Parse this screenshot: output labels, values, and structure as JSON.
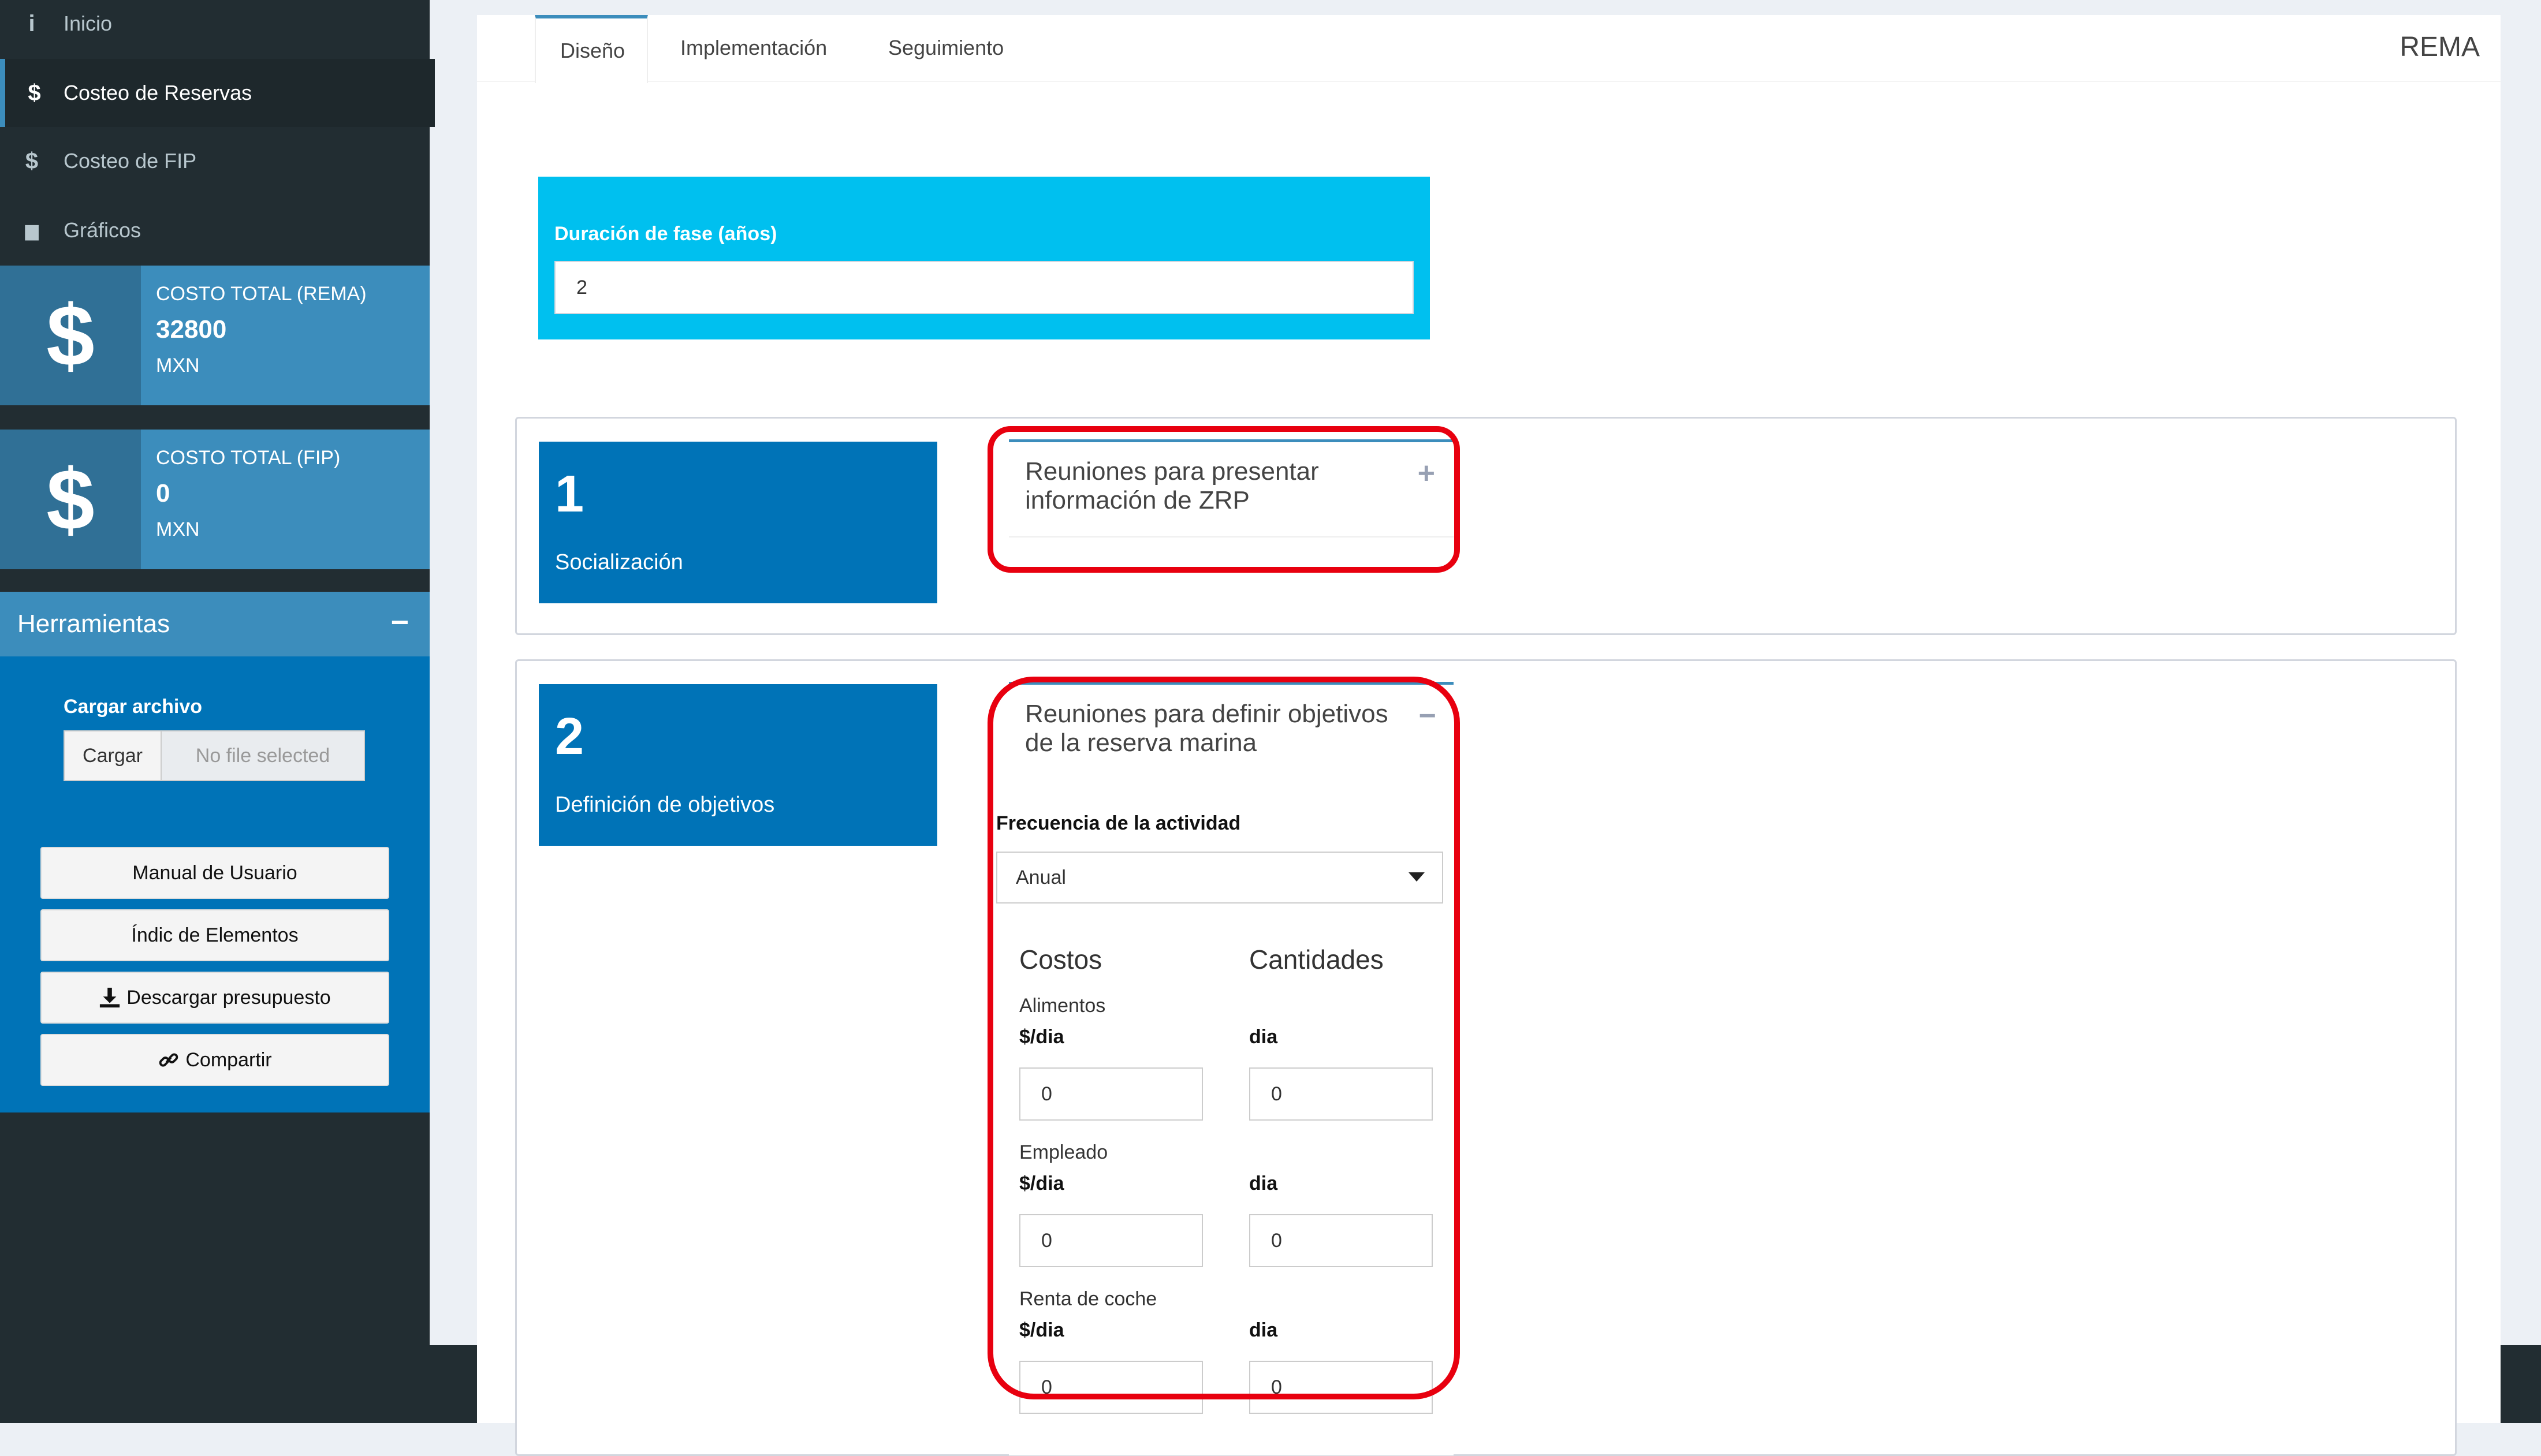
{
  "sidebar": {
    "nav": [
      {
        "icon": "info-icon",
        "glyph": "i",
        "label": "Inicio"
      },
      {
        "icon": "dollar-icon",
        "glyph": "$",
        "label": "Costeo de Reservas"
      },
      {
        "icon": "dollar-icon",
        "glyph": "$",
        "label": "Costeo de FIP"
      },
      {
        "icon": "bar-chart-icon",
        "glyph": "▆",
        "label": "Gráficos"
      }
    ],
    "infoboxes": [
      {
        "title": "COSTO TOTAL (REMA)",
        "value": "32800",
        "unit": "MXN"
      },
      {
        "title": "COSTO TOTAL (FIP)",
        "value": "0",
        "unit": "MXN"
      }
    ],
    "tools": {
      "title": "Herramientas",
      "collapse": "−",
      "file_label": "Cargar archivo",
      "file_button": "Cargar",
      "file_status": "No file selected",
      "buttons": [
        "Manual de Usuario",
        "Índic de Elementos",
        "Descargar presupuesto",
        "Compartir"
      ]
    }
  },
  "main": {
    "tabs": [
      "Diseño",
      "Implementación",
      "Seguimiento"
    ],
    "active_tab": "Diseño",
    "brand": "REMA",
    "duration": {
      "label": "Duración de fase (años)",
      "value": "2"
    },
    "phases": [
      {
        "number": "1",
        "name": "Socialización",
        "activity_title": "Reuniones para presentar información de ZRP",
        "tool": "+"
      },
      {
        "number": "2",
        "name": "Definición de objetivos",
        "activity_title": "Reuniones para definir objetivos de la reserva marina",
        "tool": "−"
      }
    ],
    "activity": {
      "frequency_label": "Frecuencia de la actividad",
      "frequency_value": "Anual",
      "costs_header": "Costos",
      "qty_header": "Cantidades",
      "items": [
        {
          "name": "Alimentos",
          "cost_unit": "$/dia",
          "qty_unit": "dia",
          "cost": "0",
          "qty": "0"
        },
        {
          "name": "Empleado",
          "cost_unit": "$/dia",
          "qty_unit": "dia",
          "cost": "0",
          "qty": "0"
        },
        {
          "name": "Renta de coche",
          "cost_unit": "$/dia",
          "qty_unit": "dia",
          "cost": "0",
          "qty": "0"
        }
      ]
    }
  },
  "colors": {
    "highlight": "#e8000f",
    "sidebar": "#222d32",
    "primary": "#3c8dbc",
    "phase": "#0073b7",
    "aqua": "#00c0ef"
  }
}
